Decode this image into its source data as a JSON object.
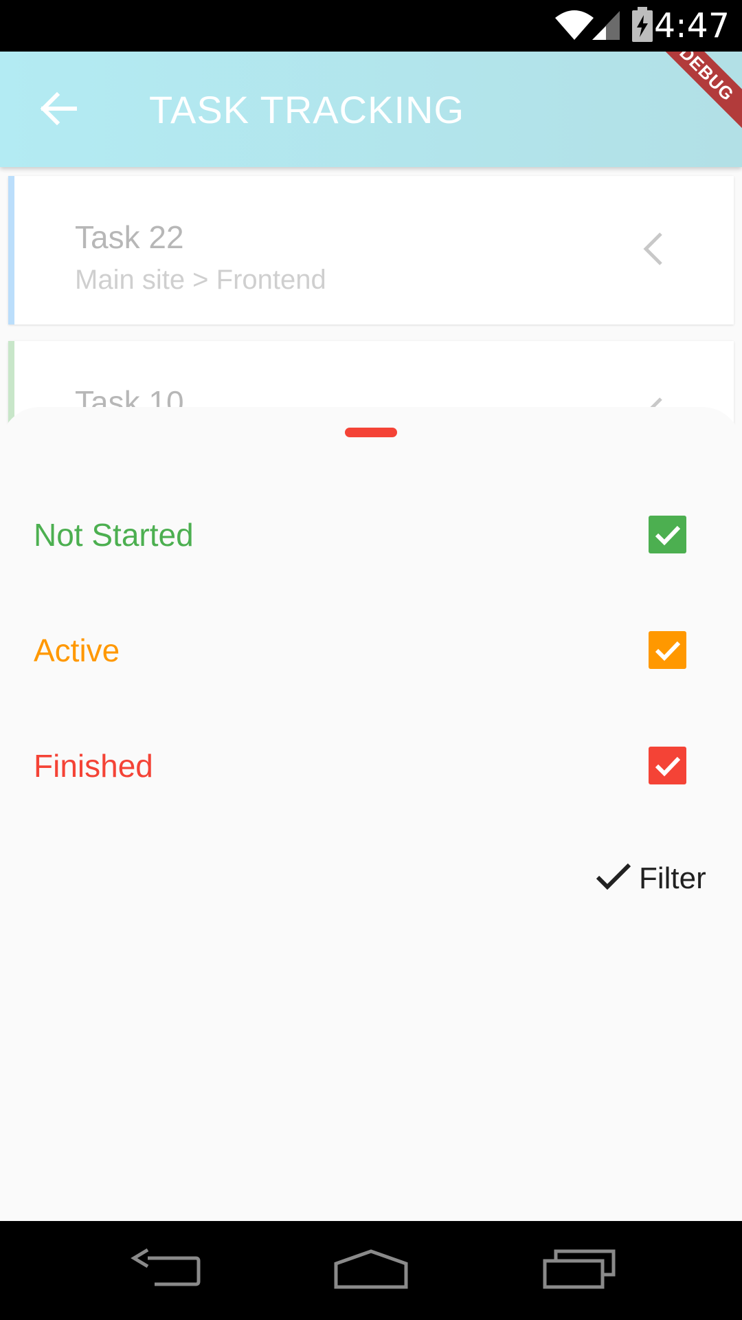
{
  "status_bar": {
    "time": "4:47",
    "icons": [
      "wifi-icon",
      "cell-signal-icon",
      "battery-charging-icon"
    ]
  },
  "app_bar": {
    "title": "TASK TRACKING",
    "back_icon": "arrow-left-icon",
    "debug_banner": "DEBUG",
    "gradient": [
      "#b3ebf3",
      "#b2e0e6"
    ]
  },
  "tasks": [
    {
      "name": "Task 22",
      "path": "Main site > Frontend",
      "accent": "#bbdefb"
    },
    {
      "name": "Task 10",
      "path": "",
      "accent": "#c8e6c9"
    }
  ],
  "bottom_sheet": {
    "handle_color": "#f44336",
    "filters": [
      {
        "label": "Not Started",
        "checked": true,
        "color": "#4caf50"
      },
      {
        "label": "Active",
        "checked": true,
        "color": "#ff9800"
      },
      {
        "label": "Finished",
        "checked": true,
        "color": "#f44336"
      }
    ],
    "filter_button": {
      "label": "Filter",
      "icon": "check-icon"
    }
  },
  "nav_bar": {
    "icons": [
      "back-nav-icon",
      "home-nav-icon",
      "recents-nav-icon"
    ]
  }
}
